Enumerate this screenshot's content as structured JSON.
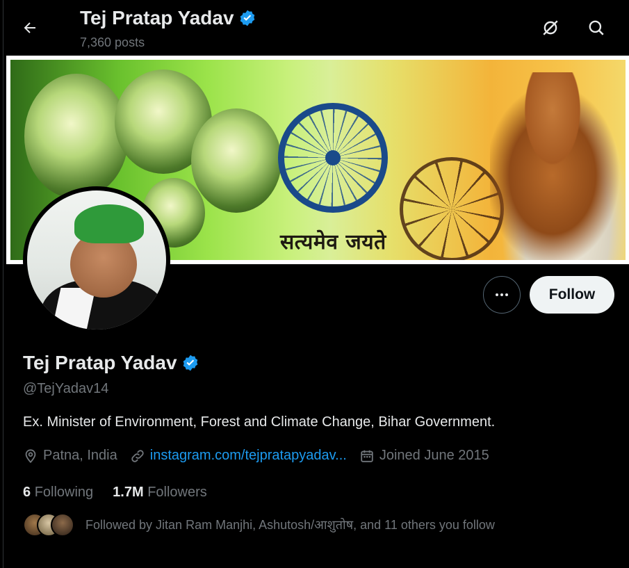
{
  "header": {
    "title": "Tej Pratap Yadav",
    "posts": "7,360 posts"
  },
  "banner": {
    "motto": "सत्यमेव जयते"
  },
  "profile": {
    "name": "Tej Pratap Yadav",
    "handle": "@TejYadav14",
    "bio": "Ex. Minister of Environment, Forest and Climate Change, Bihar Government.",
    "location": "Patna, India",
    "website": "instagram.com/tejpratapyadav...",
    "joined": "Joined June 2015",
    "following_count": "6",
    "following_label": "Following",
    "followers_count": "1.7M",
    "followers_label": "Followers",
    "followed_by": "Followed by Jitan Ram Manjhi, Ashutosh/आशुतोष, and 11 others you follow"
  },
  "actions": {
    "follow_label": "Follow"
  },
  "icons": {
    "back": "back-arrow-icon",
    "grok": "grok-icon",
    "search": "search-icon",
    "verified": "verified-badge-icon",
    "more": "more-icon",
    "location": "location-pin-icon",
    "link": "link-icon",
    "calendar": "calendar-icon"
  },
  "colors": {
    "accent": "#1d9bf0",
    "muted": "#71767b",
    "text": "#e7e9ea",
    "background": "#000000"
  }
}
